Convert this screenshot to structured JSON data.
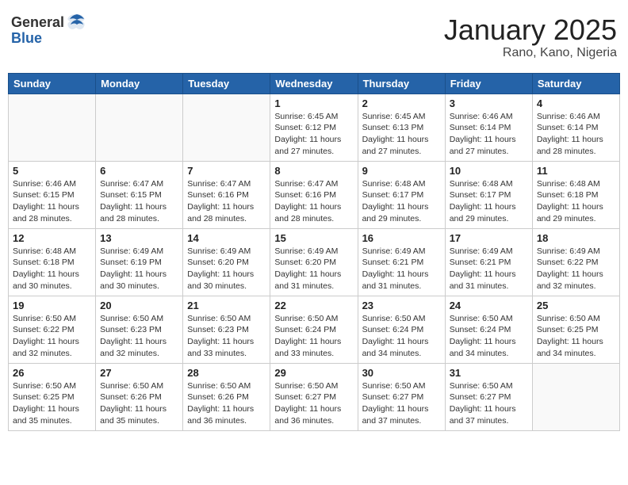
{
  "header": {
    "logo_general": "General",
    "logo_blue": "Blue",
    "month_title": "January 2025",
    "location": "Rano, Kano, Nigeria"
  },
  "weekdays": [
    "Sunday",
    "Monday",
    "Tuesday",
    "Wednesday",
    "Thursday",
    "Friday",
    "Saturday"
  ],
  "weeks": [
    [
      {
        "day": "",
        "info": ""
      },
      {
        "day": "",
        "info": ""
      },
      {
        "day": "",
        "info": ""
      },
      {
        "day": "1",
        "info": "Sunrise: 6:45 AM\nSunset: 6:12 PM\nDaylight: 11 hours\nand 27 minutes."
      },
      {
        "day": "2",
        "info": "Sunrise: 6:45 AM\nSunset: 6:13 PM\nDaylight: 11 hours\nand 27 minutes."
      },
      {
        "day": "3",
        "info": "Sunrise: 6:46 AM\nSunset: 6:14 PM\nDaylight: 11 hours\nand 27 minutes."
      },
      {
        "day": "4",
        "info": "Sunrise: 6:46 AM\nSunset: 6:14 PM\nDaylight: 11 hours\nand 28 minutes."
      }
    ],
    [
      {
        "day": "5",
        "info": "Sunrise: 6:46 AM\nSunset: 6:15 PM\nDaylight: 11 hours\nand 28 minutes."
      },
      {
        "day": "6",
        "info": "Sunrise: 6:47 AM\nSunset: 6:15 PM\nDaylight: 11 hours\nand 28 minutes."
      },
      {
        "day": "7",
        "info": "Sunrise: 6:47 AM\nSunset: 6:16 PM\nDaylight: 11 hours\nand 28 minutes."
      },
      {
        "day": "8",
        "info": "Sunrise: 6:47 AM\nSunset: 6:16 PM\nDaylight: 11 hours\nand 28 minutes."
      },
      {
        "day": "9",
        "info": "Sunrise: 6:48 AM\nSunset: 6:17 PM\nDaylight: 11 hours\nand 29 minutes."
      },
      {
        "day": "10",
        "info": "Sunrise: 6:48 AM\nSunset: 6:17 PM\nDaylight: 11 hours\nand 29 minutes."
      },
      {
        "day": "11",
        "info": "Sunrise: 6:48 AM\nSunset: 6:18 PM\nDaylight: 11 hours\nand 29 minutes."
      }
    ],
    [
      {
        "day": "12",
        "info": "Sunrise: 6:48 AM\nSunset: 6:18 PM\nDaylight: 11 hours\nand 30 minutes."
      },
      {
        "day": "13",
        "info": "Sunrise: 6:49 AM\nSunset: 6:19 PM\nDaylight: 11 hours\nand 30 minutes."
      },
      {
        "day": "14",
        "info": "Sunrise: 6:49 AM\nSunset: 6:20 PM\nDaylight: 11 hours\nand 30 minutes."
      },
      {
        "day": "15",
        "info": "Sunrise: 6:49 AM\nSunset: 6:20 PM\nDaylight: 11 hours\nand 31 minutes."
      },
      {
        "day": "16",
        "info": "Sunrise: 6:49 AM\nSunset: 6:21 PM\nDaylight: 11 hours\nand 31 minutes."
      },
      {
        "day": "17",
        "info": "Sunrise: 6:49 AM\nSunset: 6:21 PM\nDaylight: 11 hours\nand 31 minutes."
      },
      {
        "day": "18",
        "info": "Sunrise: 6:49 AM\nSunset: 6:22 PM\nDaylight: 11 hours\nand 32 minutes."
      }
    ],
    [
      {
        "day": "19",
        "info": "Sunrise: 6:50 AM\nSunset: 6:22 PM\nDaylight: 11 hours\nand 32 minutes."
      },
      {
        "day": "20",
        "info": "Sunrise: 6:50 AM\nSunset: 6:23 PM\nDaylight: 11 hours\nand 32 minutes."
      },
      {
        "day": "21",
        "info": "Sunrise: 6:50 AM\nSunset: 6:23 PM\nDaylight: 11 hours\nand 33 minutes."
      },
      {
        "day": "22",
        "info": "Sunrise: 6:50 AM\nSunset: 6:24 PM\nDaylight: 11 hours\nand 33 minutes."
      },
      {
        "day": "23",
        "info": "Sunrise: 6:50 AM\nSunset: 6:24 PM\nDaylight: 11 hours\nand 34 minutes."
      },
      {
        "day": "24",
        "info": "Sunrise: 6:50 AM\nSunset: 6:24 PM\nDaylight: 11 hours\nand 34 minutes."
      },
      {
        "day": "25",
        "info": "Sunrise: 6:50 AM\nSunset: 6:25 PM\nDaylight: 11 hours\nand 34 minutes."
      }
    ],
    [
      {
        "day": "26",
        "info": "Sunrise: 6:50 AM\nSunset: 6:25 PM\nDaylight: 11 hours\nand 35 minutes."
      },
      {
        "day": "27",
        "info": "Sunrise: 6:50 AM\nSunset: 6:26 PM\nDaylight: 11 hours\nand 35 minutes."
      },
      {
        "day": "28",
        "info": "Sunrise: 6:50 AM\nSunset: 6:26 PM\nDaylight: 11 hours\nand 36 minutes."
      },
      {
        "day": "29",
        "info": "Sunrise: 6:50 AM\nSunset: 6:27 PM\nDaylight: 11 hours\nand 36 minutes."
      },
      {
        "day": "30",
        "info": "Sunrise: 6:50 AM\nSunset: 6:27 PM\nDaylight: 11 hours\nand 37 minutes."
      },
      {
        "day": "31",
        "info": "Sunrise: 6:50 AM\nSunset: 6:27 PM\nDaylight: 11 hours\nand 37 minutes."
      },
      {
        "day": "",
        "info": ""
      }
    ]
  ]
}
